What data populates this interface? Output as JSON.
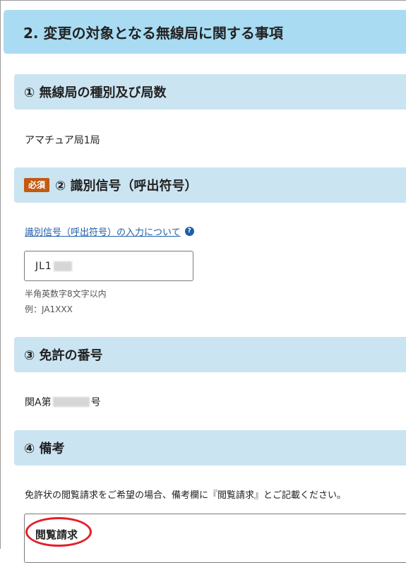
{
  "main_header": {
    "title": "2. 変更の対象となる無線局に関する事項"
  },
  "section1": {
    "title": "① 無線局の種別及び局数",
    "value": "アマチュア局1局"
  },
  "section2": {
    "badge": "必須",
    "title": "② 識別信号（呼出符号）",
    "help_link": "識別信号（呼出符号）の入力について",
    "help_icon": "?",
    "input_value_prefix": "JL1",
    "hint": "半角英数字8文字以内",
    "example": "例：JA1XXX"
  },
  "section3": {
    "title": "③ 免許の番号",
    "value_prefix": "関A第",
    "value_suffix": "号"
  },
  "section4": {
    "title": "④ 備考",
    "note": "免許状の閲覧請求をご希望の場合、備考欄に『閲覧請求』とご記載ください。",
    "textarea_value": "閲覧請求"
  },
  "colors": {
    "main_header_bg": "#a9dcf3",
    "section_header_bg": "#cbe4f1",
    "badge_bg": "#c25a12",
    "link": "#1f5fa8",
    "highlight_circle": "#e41e2a"
  }
}
